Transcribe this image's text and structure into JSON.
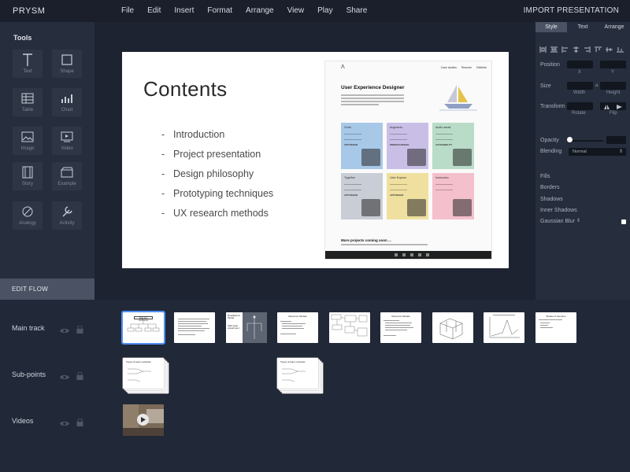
{
  "app": {
    "name": "PRYSM"
  },
  "menu": [
    "File",
    "Edit",
    "Insert",
    "Format",
    "Arrange",
    "View",
    "Play",
    "Share"
  ],
  "import_label": "IMPORT PRESENTATION",
  "tools": {
    "title": "Tools",
    "items": [
      {
        "label": "Text",
        "icon": "text-icon"
      },
      {
        "label": "Shape",
        "icon": "shape-icon"
      },
      {
        "label": "Table",
        "icon": "table-icon"
      },
      {
        "label": "Chart",
        "icon": "chart-icon"
      },
      {
        "label": "Image",
        "icon": "image-icon"
      },
      {
        "label": "Video",
        "icon": "video-icon"
      },
      {
        "label": "Story",
        "icon": "story-icon"
      },
      {
        "label": "Example",
        "icon": "example-icon"
      },
      {
        "label": "Analogy",
        "icon": "analogy-icon"
      },
      {
        "label": "Activity",
        "icon": "activity-icon"
      }
    ]
  },
  "edit_flow": "EDIT FLOW",
  "slide": {
    "title": "Contents",
    "items": [
      "Introduction",
      "Project presentation",
      "Design philosophy",
      "Prototyping techniques",
      "UX research methods"
    ],
    "embed": {
      "nav": [
        "Case studies",
        "Resume",
        "Dribbble"
      ],
      "heading": "User Experience Designer",
      "cards": [
        {
          "title": "Circle",
          "tag": "APP DESIGN",
          "color": "#a8c8e8"
        },
        {
          "title": "Augmento",
          "tag": "WEBSITE DESIGN",
          "color": "#c9bfe6"
        },
        {
          "title": "Audio assist",
          "tag": "ACCESSIBILITY",
          "color": "#b8dcc8"
        },
        {
          "title": "Together",
          "tag": "APP DESIGN",
          "color": "#c9cdd6"
        },
        {
          "title": "Uber Explore",
          "tag": "APP DESIGN",
          "color": "#efe0a0"
        },
        {
          "title": "Instruction",
          "tag": "",
          "color": "#f4c0cc"
        }
      ],
      "footer": "More projects coming soon ..."
    }
  },
  "props": {
    "tabs": [
      "Style",
      "Text",
      "Arrange"
    ],
    "position_label": "Position",
    "size_label": "Size",
    "transform_label": "Transform",
    "x_label": "X",
    "y_label": "Y",
    "width_label": "Width",
    "height_label": "Height",
    "rotate_label": "Rotate",
    "flip_label": "Flip",
    "opacity_label": "Opacity",
    "blending_label": "Blending",
    "blending_value": "Normal",
    "effects": [
      "Fills",
      "Borders",
      "Shadows",
      "Inner Shadows",
      "Gaussian Blur"
    ],
    "accent": "#4f8ff7"
  },
  "tracks": [
    {
      "label": "Main track"
    },
    {
      "label": "Sub-points"
    },
    {
      "label": "Videos"
    }
  ],
  "thumbs": {
    "first_title": "Flow of a conference",
    "t3_title": "Broadbent's Model",
    "t3_sub": "Split span experiment",
    "t4_title": "Resource Models",
    "t6_title": "Resource Models",
    "t10_title": "Modes of retention",
    "sub_title": "Types of team networks"
  }
}
